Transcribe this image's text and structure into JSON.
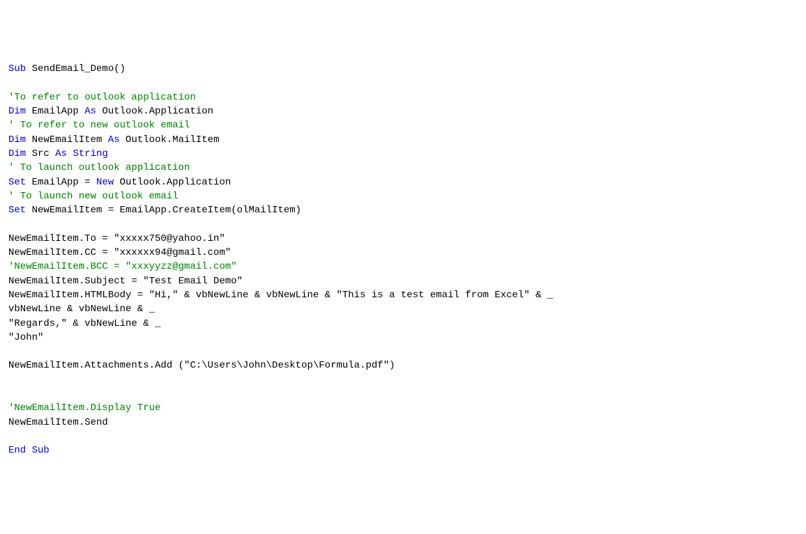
{
  "code": {
    "lines": [
      {
        "type": "mixed",
        "parts": [
          {
            "cls": "kw",
            "t": "Sub"
          },
          {
            "cls": "pl",
            "t": " SendEmail_Demo()"
          }
        ]
      },
      {
        "type": "blank"
      },
      {
        "type": "comment",
        "t": "'To refer to outlook application"
      },
      {
        "type": "mixed",
        "parts": [
          {
            "cls": "kw",
            "t": "Dim"
          },
          {
            "cls": "pl",
            "t": " EmailApp "
          },
          {
            "cls": "kw",
            "t": "As"
          },
          {
            "cls": "pl",
            "t": " Outlook.Application"
          }
        ]
      },
      {
        "type": "comment",
        "t": "' To refer to new outlook email"
      },
      {
        "type": "mixed",
        "parts": [
          {
            "cls": "kw",
            "t": "Dim"
          },
          {
            "cls": "pl",
            "t": " NewEmailItem "
          },
          {
            "cls": "kw",
            "t": "As"
          },
          {
            "cls": "pl",
            "t": " Outlook.MailItem"
          }
        ]
      },
      {
        "type": "mixed",
        "parts": [
          {
            "cls": "kw",
            "t": "Dim"
          },
          {
            "cls": "pl",
            "t": " Src "
          },
          {
            "cls": "kw",
            "t": "As String"
          }
        ]
      },
      {
        "type": "comment",
        "t": "' To launch outlook application"
      },
      {
        "type": "mixed",
        "parts": [
          {
            "cls": "kw",
            "t": "Set"
          },
          {
            "cls": "pl",
            "t": " EmailApp = "
          },
          {
            "cls": "kw",
            "t": "New"
          },
          {
            "cls": "pl",
            "t": " Outlook.Application"
          }
        ]
      },
      {
        "type": "comment",
        "t": "' To launch new outlook email"
      },
      {
        "type": "mixed",
        "parts": [
          {
            "cls": "kw",
            "t": "Set"
          },
          {
            "cls": "pl",
            "t": " NewEmailItem = EmailApp.CreateItem(olMailItem)"
          }
        ]
      },
      {
        "type": "blank"
      },
      {
        "type": "plain",
        "t": "NewEmailItem.To = \"xxxxx750@yahoo.in\""
      },
      {
        "type": "plain",
        "t": "NewEmailItem.CC = \"xxxxxx94@gmail.com\""
      },
      {
        "type": "comment",
        "t": "'NewEmailItem.BCC = \"xxxyyzz@gmail.com\""
      },
      {
        "type": "plain",
        "t": "NewEmailItem.Subject = \"Test Email Demo\""
      },
      {
        "type": "plain",
        "t": "NewEmailItem.HTMLBody = \"Hi,\" & vbNewLine & vbNewLine & \"This is a test email from Excel\" & _"
      },
      {
        "type": "plain",
        "t": "vbNewLine & vbNewLine & _"
      },
      {
        "type": "plain",
        "t": "\"Regards,\" & vbNewLine & _"
      },
      {
        "type": "plain",
        "t": "\"John\""
      },
      {
        "type": "blank"
      },
      {
        "type": "plain",
        "t": "NewEmailItem.Attachments.Add (\"C:\\Users\\John\\Desktop\\Formula.pdf\")"
      },
      {
        "type": "blank"
      },
      {
        "type": "blank"
      },
      {
        "type": "comment",
        "t": "'NewEmailItem.Display True"
      },
      {
        "type": "plain",
        "t": "NewEmailItem.Send"
      },
      {
        "type": "blank"
      },
      {
        "type": "mixed",
        "parts": [
          {
            "cls": "kw",
            "t": "End Sub"
          }
        ]
      }
    ]
  }
}
